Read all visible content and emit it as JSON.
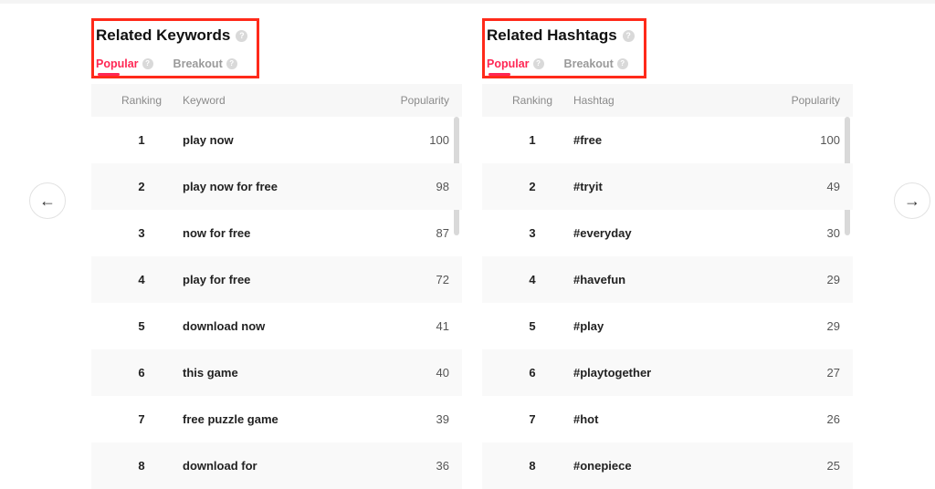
{
  "keywords_panel": {
    "title": "Related Keywords",
    "tabs": {
      "popular": "Popular",
      "breakout": "Breakout"
    },
    "columns": {
      "rank": "Ranking",
      "keyword": "Keyword",
      "popularity": "Popularity"
    },
    "rows": [
      {
        "rank": "1",
        "keyword": "play now",
        "popularity": "100"
      },
      {
        "rank": "2",
        "keyword": "play now for free",
        "popularity": "98"
      },
      {
        "rank": "3",
        "keyword": "now for free",
        "popularity": "87"
      },
      {
        "rank": "4",
        "keyword": "play for free",
        "popularity": "72"
      },
      {
        "rank": "5",
        "keyword": "download now",
        "popularity": "41"
      },
      {
        "rank": "6",
        "keyword": "this game",
        "popularity": "40"
      },
      {
        "rank": "7",
        "keyword": "free puzzle game",
        "popularity": "39"
      },
      {
        "rank": "8",
        "keyword": "download for",
        "popularity": "36"
      }
    ]
  },
  "hashtags_panel": {
    "title": "Related Hashtags",
    "tabs": {
      "popular": "Popular",
      "breakout": "Breakout"
    },
    "columns": {
      "rank": "Ranking",
      "hashtag": "Hashtag",
      "popularity": "Popularity"
    },
    "rows": [
      {
        "rank": "1",
        "hashtag": "#free",
        "popularity": "100"
      },
      {
        "rank": "2",
        "hashtag": "#tryit",
        "popularity": "49"
      },
      {
        "rank": "3",
        "hashtag": "#everyday",
        "popularity": "30"
      },
      {
        "rank": "4",
        "hashtag": "#havefun",
        "popularity": "29"
      },
      {
        "rank": "5",
        "hashtag": "#play",
        "popularity": "29"
      },
      {
        "rank": "6",
        "hashtag": "#playtogether",
        "popularity": "27"
      },
      {
        "rank": "7",
        "hashtag": "#hot",
        "popularity": "26"
      },
      {
        "rank": "8",
        "hashtag": "#onepiece",
        "popularity": "25"
      }
    ]
  }
}
